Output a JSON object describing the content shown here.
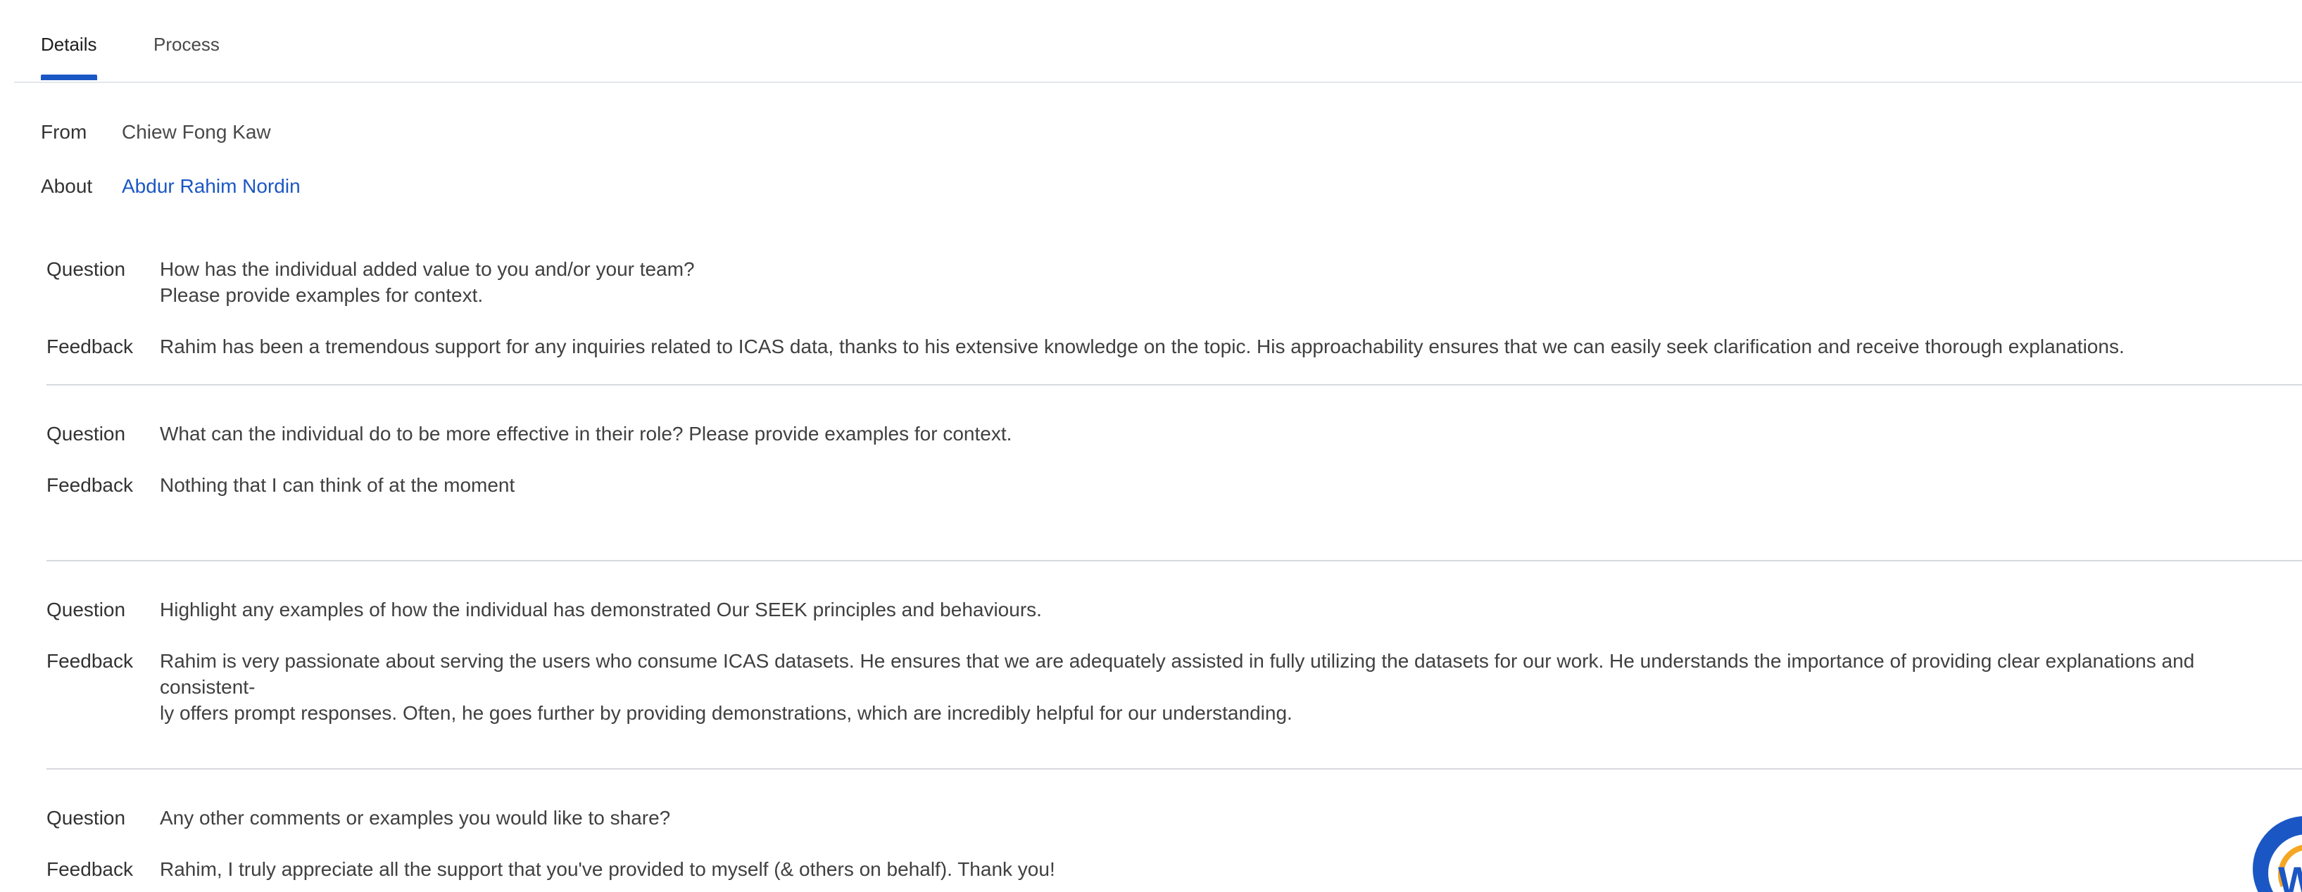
{
  "tabs": [
    {
      "label": "Details",
      "active": true
    },
    {
      "label": "Process",
      "active": false
    }
  ],
  "meta": {
    "from_label": "From",
    "from_value": "Chiew Fong Kaw",
    "about_label": "About",
    "about_value": "Abdur Rahim Nordin"
  },
  "qa": [
    {
      "question_label": "Question",
      "question": "How has the individual added value to you and/or your team?\nPlease provide examples for context.",
      "feedback_label": "Feedback",
      "feedback": "Rahim has been a tremendous support for any inquiries related to ICAS data, thanks to his extensive knowledge on the topic. His approachability ensures that we can easily seek clarification and receive thorough explanations."
    },
    {
      "question_label": "Question",
      "question": "What can the individual do to be more effective in their role? Please provide examples for context.",
      "feedback_label": "Feedback",
      "feedback": "Nothing that I can think of at the moment"
    },
    {
      "question_label": "Question",
      "question": "Highlight any examples of how the individual has demonstrated Our SEEK principles and behaviours.",
      "feedback_label": "Feedback",
      "feedback": "Rahim is very passionate about serving the users who consume ICAS datasets. He ensures that we are adequately assisted in fully utilizing the datasets for our work. He understands the importance of providing clear explanations and consistent-\nly offers prompt responses. Often, he goes further by providing demonstrations, which are incredibly helpful for our understanding."
    },
    {
      "question_label": "Question",
      "question": "Any other comments or examples you would like to share?",
      "feedback_label": "Feedback",
      "feedback": "Rahim, I truly appreciate all the support that you've provided to myself (& others on behalf). Thank you!"
    }
  ],
  "help_bubble": {
    "icon": "workday-help-icon",
    "letter": "W"
  },
  "colors": {
    "accent": "#1b57c4",
    "text": "#333333",
    "divider": "#d7dadd"
  }
}
